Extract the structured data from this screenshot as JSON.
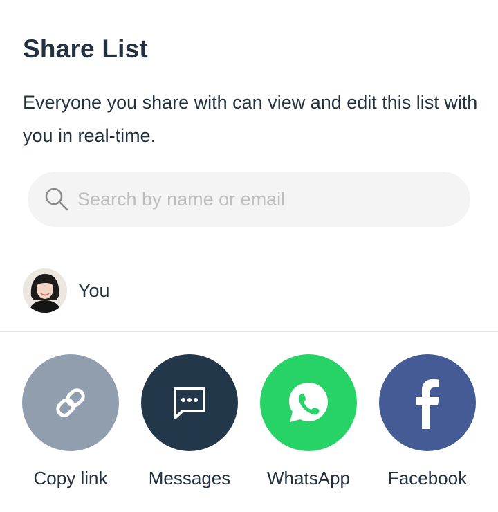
{
  "header": {
    "title": "Share List",
    "description": "Everyone you share with can view and edit this list with you in real-time."
  },
  "search": {
    "placeholder": "Search by name or email",
    "value": "",
    "icon": "search-icon"
  },
  "members": [
    {
      "name": "You",
      "avatar": "avatar-photo"
    }
  ],
  "share_options": [
    {
      "label": "Copy link",
      "icon": "link-icon",
      "color": "#919eae"
    },
    {
      "label": "Messages",
      "icon": "message-icon",
      "color": "#22374a"
    },
    {
      "label": "WhatsApp",
      "icon": "whatsapp-icon",
      "color": "#27d366"
    },
    {
      "label": "Facebook",
      "icon": "facebook-icon",
      "color": "#445b96"
    }
  ]
}
